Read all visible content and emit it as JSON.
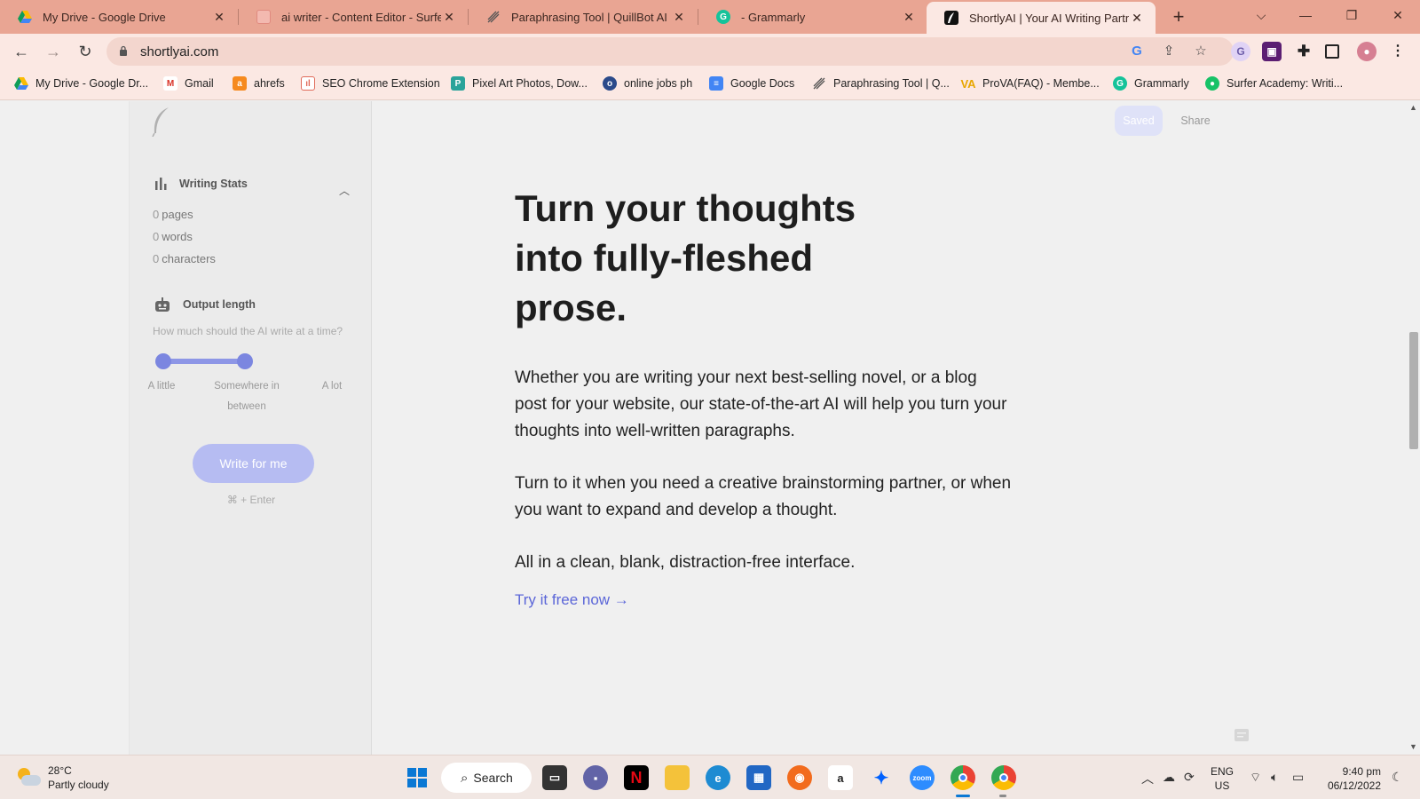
{
  "browser": {
    "tabs": [
      {
        "title": "My Drive - Google Drive",
        "active": false
      },
      {
        "title": "ai writer - Content Editor - Surfer",
        "active": false
      },
      {
        "title": "Paraphrasing Tool | QuillBot AI",
        "active": false
      },
      {
        "title": "- Grammarly",
        "active": false
      },
      {
        "title": "ShortlyAI | Your AI Writing Partner",
        "active": true
      }
    ],
    "close_glyph": "✕",
    "new_tab_glyph": "+",
    "url": "shortlyai.com",
    "accent_color": "#e9a593",
    "bookmarks": [
      {
        "label": "My Drive - Google Dr...",
        "icon": "google-drive-icon"
      },
      {
        "label": "Gmail",
        "icon": "gmail-icon"
      },
      {
        "label": "ahrefs",
        "icon": "ahrefs-icon"
      },
      {
        "label": "SEO Chrome Extension",
        "icon": "seo-extension-icon"
      },
      {
        "label": "Pixel Art Photos, Dow...",
        "icon": "pixel-art-icon"
      },
      {
        "label": "online jobs ph",
        "icon": "online-jobs-icon"
      },
      {
        "label": "Google Docs",
        "icon": "google-docs-icon"
      },
      {
        "label": "Paraphrasing Tool | Q...",
        "icon": "quillbot-icon"
      },
      {
        "label": "ProVA(FAQ) - Membe...",
        "icon": "prova-icon"
      },
      {
        "label": "Grammarly",
        "icon": "grammarly-icon"
      },
      {
        "label": "Surfer Academy: Writi...",
        "icon": "surfer-icon"
      }
    ]
  },
  "app": {
    "sidebar": {
      "writing_stats": {
        "title": "Writing Stats",
        "stats": [
          {
            "value": "0",
            "label": "pages"
          },
          {
            "value": "0",
            "label": "words"
          },
          {
            "value": "0",
            "label": "characters"
          }
        ]
      },
      "output_length": {
        "title": "Output length",
        "hint": "How much should the AI write at a time?",
        "slider_min_label": "A little",
        "slider_mid_label_line1": "Somewhere in",
        "slider_mid_label_line2": "between",
        "slider_max_label": "A lot",
        "slider_value_fraction": 1.0
      },
      "write_button": "Write for me",
      "shortcut": "⌘ + Enter"
    },
    "header": {
      "saved_label": "Saved",
      "share_label": "Share"
    },
    "content": {
      "headline_line1": "Turn your thoughts",
      "headline_line2": "into fully-fleshed",
      "headline_line3": "prose.",
      "paragraph1": "Whether you are writing your next best-selling novel, or a blog post for your website, our state-of-the-art AI will help you turn your thoughts into well-written paragraphs.",
      "paragraph2": "Turn to it when you need a creative brainstorming partner, or when you want to expand and develop a thought.",
      "paragraph3": "All in a clean, blank, distraction-free interface.",
      "cta": "Try it free now →",
      "accent_color": "#5b66d8"
    }
  },
  "taskbar": {
    "weather_temp": "28°C",
    "weather_desc": "Partly cloudy",
    "search_label": "Search",
    "lang_line1": "ENG",
    "lang_line2": "US",
    "time": "9:40 pm",
    "date": "06/12/2022"
  }
}
